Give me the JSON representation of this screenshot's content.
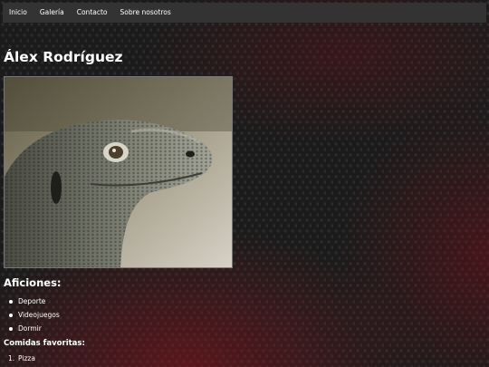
{
  "nav": {
    "links": [
      "Inicio",
      "Galería",
      "Contacto",
      "Sobre nosotros"
    ]
  },
  "profile": {
    "name": "Álex Rodríguez"
  },
  "photo": {
    "subject": "monitor-lizard"
  },
  "hobbies": {
    "title": "Aficiones:",
    "items": [
      "Deporte",
      "Videojuegos",
      "Dormir"
    ]
  },
  "foods": {
    "title": "Comidas favoritas:",
    "items": [
      "Pizza"
    ],
    "numbers": [
      "1."
    ]
  },
  "colors": {
    "background": "#1b1b1b",
    "navbar": "#333333",
    "text": "#ffffff",
    "accent_red": "#8c141e"
  }
}
